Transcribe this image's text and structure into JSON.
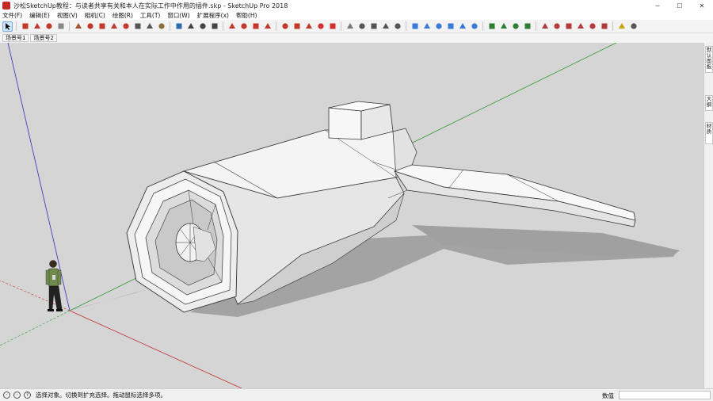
{
  "window": {
    "title": "沙松SketchUp教程：与读者共享有关和本人在实际工作中作用的插件.skp - SketchUp Pro 2018",
    "minimize": "─",
    "maximize": "☐",
    "close": "✕"
  },
  "menu": [
    "文件(F)",
    "编辑(E)",
    "视图(V)",
    "相机(C)",
    "绘图(R)",
    "工具(T)",
    "窗口(W)",
    "扩展程序(x)",
    "帮助(H)"
  ],
  "scenes": [
    "场景号1",
    "场景号2"
  ],
  "tray_tabs": [
    "默认面板",
    "大纲",
    "材质"
  ],
  "status": {
    "text": "选择对象。切换到扩充选择。拖动鼠标选择多项。",
    "measure_label": "数值",
    "measure_value": ""
  },
  "colors": {
    "viewport": "#d5d5d5",
    "red_axis": "#c03030",
    "green_axis": "#2e9a2e",
    "blue_axis": "#3030c0",
    "shadow": "#a0a0a0"
  },
  "toolbar_icons": [
    "select-arrow-icon",
    "eraser-icon",
    "pencil-icon",
    "arc-icon",
    "shape-icon",
    "push-pull-icon",
    "move-icon",
    "rotate-icon",
    "scale-icon",
    "offset-icon",
    "tape-measure-icon",
    "text-icon",
    "paint-bucket-icon",
    "orbit-icon",
    "pan-icon",
    "zoom-icon",
    "zoom-extents-icon",
    "warehouse-icon",
    "extension-warehouse-icon",
    "layout-icon",
    "ruby-icon",
    "settings-icon",
    "component-icon",
    "camera-icon",
    "red-box-icon",
    "red-square-icon",
    "view-iso-icon",
    "view-top-icon",
    "view-front-icon",
    "view-right-icon",
    "view-back-icon",
    "xray-icon",
    "wireframe-icon",
    "hidden-line-icon",
    "shaded-icon",
    "textured-icon",
    "monochrome-icon",
    "section-plane-icon",
    "section-display-icon",
    "section-cut-icon",
    "section-fill-icon",
    "solid-tools-icon",
    "intersect-icon",
    "union-icon",
    "subtract-icon",
    "trim-icon",
    "split-icon",
    "geo-location-icon",
    "plugin-icon"
  ]
}
